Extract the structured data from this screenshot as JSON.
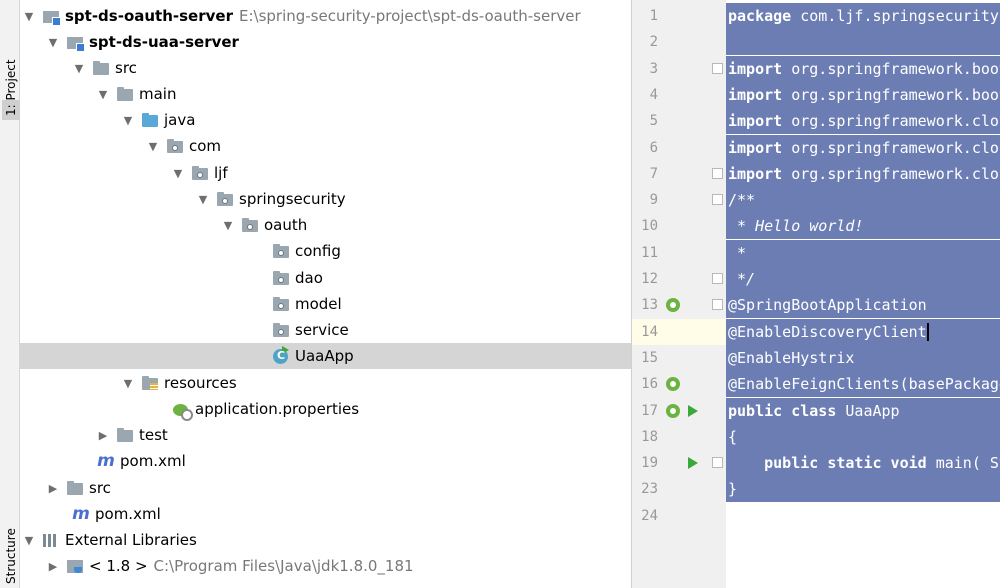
{
  "toolstripe": {
    "project_tab": "1: Project",
    "structure_tab": "Structure"
  },
  "tree": {
    "rows": [
      {
        "label": "spt-ds-oauth-server",
        "path": "E:\\spring-security-project\\spt-ds-oauth-server",
        "icon": "module-icon"
      },
      {
        "label": "spt-ds-uaa-server",
        "icon": "module-icon"
      },
      {
        "label": "src",
        "icon": "folder-icon"
      },
      {
        "label": "main",
        "icon": "folder-icon"
      },
      {
        "label": "java",
        "icon": "source-folder-icon"
      },
      {
        "label": "com",
        "icon": "package-icon"
      },
      {
        "label": "ljf",
        "icon": "package-icon"
      },
      {
        "label": "springsecurity",
        "icon": "package-icon"
      },
      {
        "label": "oauth",
        "icon": "package-icon"
      },
      {
        "label": "config",
        "icon": "package-icon"
      },
      {
        "label": "dao",
        "icon": "package-icon"
      },
      {
        "label": "model",
        "icon": "package-icon"
      },
      {
        "label": "service",
        "icon": "package-icon"
      },
      {
        "label": "UaaApp",
        "icon": "spring-class-icon"
      },
      {
        "label": "resources",
        "icon": "resources-folder-icon"
      },
      {
        "label": "application.properties",
        "icon": "spring-properties-icon"
      },
      {
        "label": "test",
        "icon": "folder-icon"
      },
      {
        "label": "pom.xml",
        "icon": "maven-icon"
      },
      {
        "label": "src",
        "icon": "folder-icon"
      },
      {
        "label": "pom.xml",
        "icon": "maven-icon"
      },
      {
        "label": "External Libraries",
        "icon": "libraries-icon"
      },
      {
        "label": "< 1.8 >",
        "path": "C:\\Program Files\\Java\\jdk1.8.0_181",
        "icon": "jdk-icon"
      }
    ]
  },
  "editor": {
    "line_numbers": [
      "1",
      "2",
      "3",
      "4",
      "5",
      "6",
      "7",
      "9",
      "10",
      "11",
      "12",
      "13",
      "14",
      "15",
      "16",
      "17",
      "18",
      "19",
      "23",
      "24"
    ],
    "lines": [
      {
        "kw": "package",
        "rest": " com.ljf.springsecurity."
      },
      {
        "kw": "",
        "rest": ""
      },
      {
        "kw": "import",
        "rest": " org.springframework.boot"
      },
      {
        "kw": "import",
        "rest": " org.springframework.boot"
      },
      {
        "kw": "import",
        "rest": " org.springframework.clou"
      },
      {
        "kw": "import",
        "rest": " org.springframework.clou"
      },
      {
        "kw": "import",
        "rest": " org.springframework.clou"
      },
      {
        "kw": "",
        "rest": "/**"
      },
      {
        "kw": "",
        "rest": " * Hello world!"
      },
      {
        "kw": "",
        "rest": " *"
      },
      {
        "kw": "",
        "rest": " */"
      },
      {
        "kw": "",
        "rest": "@SpringBootApplication"
      },
      {
        "kw": "",
        "rest": "@EnableDiscoveryClient"
      },
      {
        "kw": "",
        "rest": "@EnableHystrix"
      },
      {
        "kw": "",
        "rest": "@EnableFeignClients(basePackage"
      },
      {
        "kw": "public class",
        "rest": " UaaApp"
      },
      {
        "kw": "",
        "rest": "{"
      },
      {
        "kw": "    public static void",
        "rest": " main( St"
      },
      {
        "kw": "",
        "rest": "}"
      },
      {
        "kw": "",
        "rest": ""
      }
    ]
  }
}
